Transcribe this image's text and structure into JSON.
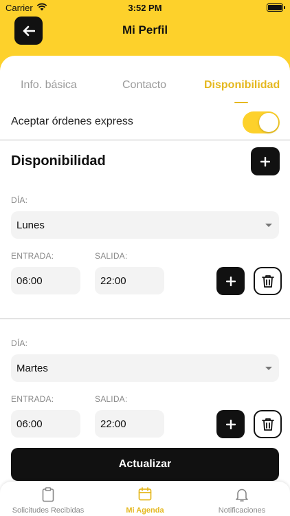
{
  "status_bar": {
    "carrier": "Carrier",
    "time": "3:52 PM"
  },
  "header": {
    "title": "Mi Perfil"
  },
  "tabs": [
    {
      "label": "Info. básica"
    },
    {
      "label": "Contacto"
    },
    {
      "label": "Disponibilidad"
    }
  ],
  "express": {
    "label": "Aceptar órdenes express",
    "enabled": true
  },
  "section": {
    "title": "Disponibilidad"
  },
  "schedules": [
    {
      "day_label": "DÍA:",
      "day": "Lunes",
      "entry_label": "ENTRADA:",
      "entry": "06:00",
      "exit_label": "SALIDA:",
      "exit": "22:00"
    },
    {
      "day_label": "DÍA:",
      "day": "Martes",
      "entry_label": "ENTRADA:",
      "entry": "06:00",
      "exit_label": "SALIDA:",
      "exit": "22:00"
    }
  ],
  "actions": {
    "update_label": "Actualizar"
  },
  "tabbar": [
    {
      "label": "Solicitudes Recibidas",
      "icon": "clipboard-icon"
    },
    {
      "label": "Mi Agenda",
      "icon": "calendar-icon"
    },
    {
      "label": "Notificaciones",
      "icon": "bell-icon"
    }
  ],
  "colors": {
    "accent": "#FDD12B",
    "accent_text": "#E5B81F",
    "dark": "#111111"
  }
}
